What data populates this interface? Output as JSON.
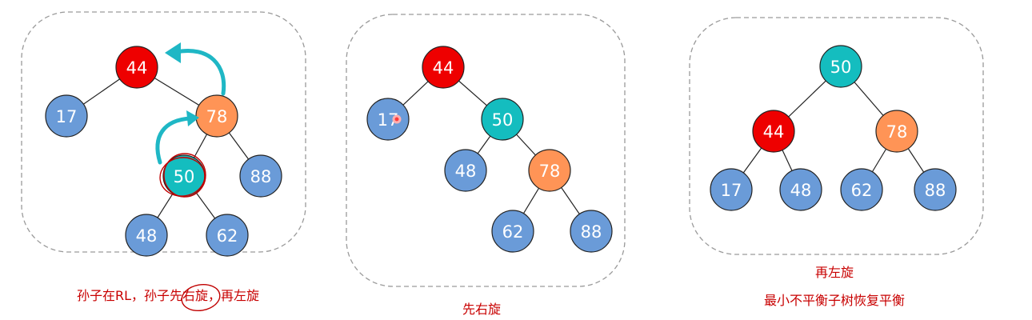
{
  "colors": {
    "red": "#ee0000",
    "orange": "#ff9456",
    "teal": "#14bdbf",
    "blue": "#6a9bd8",
    "edge": "#222222",
    "arrow": "#1fb7c5",
    "caption": "#c80000"
  },
  "panels": [
    {
      "id": "panel-1",
      "nodes": [
        {
          "label": "44",
          "color": "red"
        },
        {
          "label": "17",
          "color": "blue"
        },
        {
          "label": "78",
          "color": "orange"
        },
        {
          "label": "50",
          "color": "teal"
        },
        {
          "label": "88",
          "color": "blue"
        },
        {
          "label": "48",
          "color": "blue"
        },
        {
          "label": "62",
          "color": "blue"
        }
      ],
      "edges": [
        [
          0,
          1
        ],
        [
          0,
          2
        ],
        [
          2,
          3
        ],
        [
          2,
          4
        ],
        [
          3,
          5
        ],
        [
          3,
          6
        ]
      ],
      "captions": [
        "孙子在RL，孙子先右旋，再左旋"
      ]
    },
    {
      "id": "panel-2",
      "nodes": [
        {
          "label": "44",
          "color": "red"
        },
        {
          "label": "17",
          "color": "blue"
        },
        {
          "label": "50",
          "color": "teal"
        },
        {
          "label": "48",
          "color": "blue"
        },
        {
          "label": "78",
          "color": "orange"
        },
        {
          "label": "62",
          "color": "blue"
        },
        {
          "label": "88",
          "color": "blue"
        }
      ],
      "edges": [
        [
          0,
          1
        ],
        [
          0,
          2
        ],
        [
          2,
          3
        ],
        [
          2,
          4
        ],
        [
          4,
          5
        ],
        [
          4,
          6
        ]
      ],
      "captions": [
        "先右旋"
      ]
    },
    {
      "id": "panel-3",
      "nodes": [
        {
          "label": "50",
          "color": "teal"
        },
        {
          "label": "44",
          "color": "red"
        },
        {
          "label": "78",
          "color": "orange"
        },
        {
          "label": "17",
          "color": "blue"
        },
        {
          "label": "48",
          "color": "blue"
        },
        {
          "label": "62",
          "color": "blue"
        },
        {
          "label": "88",
          "color": "blue"
        }
      ],
      "edges": [
        [
          0,
          1
        ],
        [
          0,
          2
        ],
        [
          1,
          3
        ],
        [
          1,
          4
        ],
        [
          2,
          5
        ],
        [
          2,
          6
        ]
      ],
      "captions": [
        "再左旋",
        "最小不平衡子树恢复平衡"
      ]
    }
  ]
}
